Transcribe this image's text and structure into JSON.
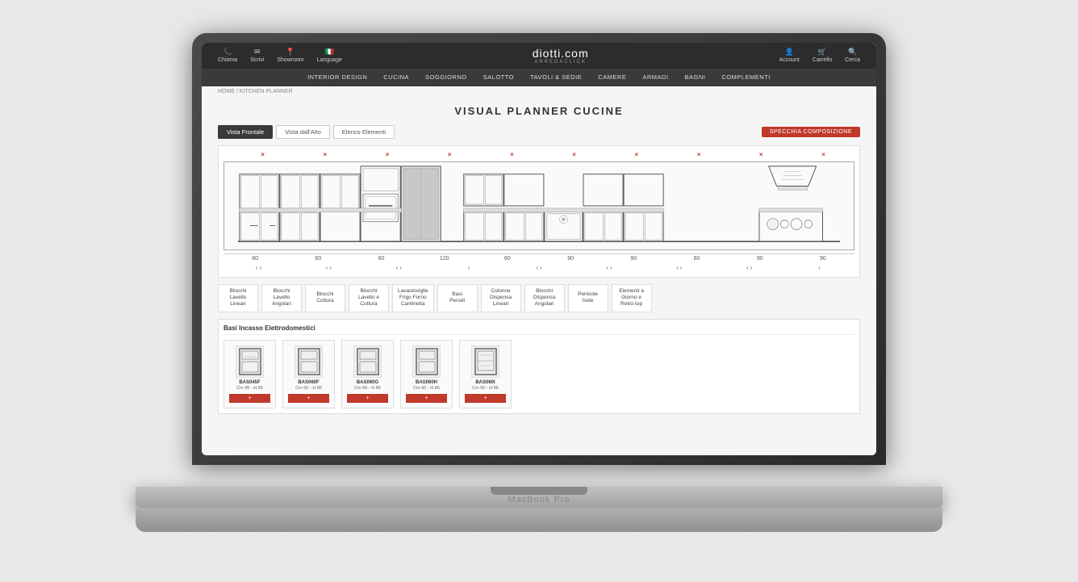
{
  "laptop": {
    "model_label": "MacBook Pro"
  },
  "website": {
    "utility_bar": {
      "items": [
        {
          "icon": "📞",
          "label": "Chiama"
        },
        {
          "icon": "✉",
          "label": "Scrivi"
        },
        {
          "icon": "📍",
          "label": "Showroom"
        },
        {
          "icon": "🇮🇹",
          "label": "Language"
        }
      ],
      "logo": "diotti.com",
      "logo_sub": "ARREDACLICK",
      "right_items": [
        {
          "icon": "👤",
          "label": "Account"
        },
        {
          "icon": "🛒",
          "label": "Carrello"
        },
        {
          "icon": "🔍",
          "label": "Cerca"
        }
      ]
    },
    "main_nav": {
      "items": [
        "INTERIOR DESIGN",
        "CUCINA",
        "SOGGIORNO",
        "SALOTTO",
        "TAVOLI & SEDIE",
        "CAMERE",
        "ARMADI",
        "BAGNI",
        "COMPLEMENTI"
      ]
    },
    "breadcrumb": "HOME / KITCHEN PLANNER",
    "page_title": "VISUAL PLANNER CUCINE",
    "tabs": [
      {
        "label": "Vista Frontale",
        "active": true
      },
      {
        "label": "Vista dall'Alto",
        "active": false
      },
      {
        "label": "Elenco Elementi",
        "active": false
      }
    ],
    "specchia_btn": "SPECCHIA COMPOSIZIONE",
    "measurements": [
      "60",
      "60",
      "60",
      "120",
      "60",
      "90",
      "90",
      "60",
      "90",
      "90"
    ],
    "categories": [
      {
        "label": "Blocchi\nLavello\nLineari"
      },
      {
        "label": "Blocchi\nLavello\nAngolari"
      },
      {
        "label": "Blocchi\nCottura"
      },
      {
        "label": "Blocchi\nLavello e\nCottura"
      },
      {
        "label": "Lavastoviglie\nFrigo Forno\nCantinetta"
      },
      {
        "label": "Basi\nPensili"
      },
      {
        "label": "Colonne\nDispensa\nLineari"
      },
      {
        "label": "Blocchi\nDispensa\nAngolari"
      },
      {
        "label": "Penisole\nIsole"
      },
      {
        "label": "Elementi a\nGiorno e\nRetrò-top"
      }
    ],
    "product_section_title": "Basi Incasso Elettrodomestici",
    "products": [
      {
        "code": "BAS045F",
        "dims": "Cm 45 - H 86",
        "icon": "🔲"
      },
      {
        "code": "BAS060F",
        "dims": "Cm 60 - H 86",
        "icon": "🔲"
      },
      {
        "code": "BAS060G",
        "dims": "Cm 60 - H 86",
        "icon": "🔲"
      },
      {
        "code": "BAS060H",
        "dims": "Cm 60 - H 86",
        "icon": "🔲"
      },
      {
        "code": "BAS060I",
        "dims": "Cm 60 - H 86",
        "icon": "🔲"
      }
    ],
    "add_btn_label": "+",
    "delete_markers": [
      "×",
      "×",
      "×",
      "×",
      "×",
      "×",
      "×",
      "×",
      "×",
      "×"
    ]
  }
}
